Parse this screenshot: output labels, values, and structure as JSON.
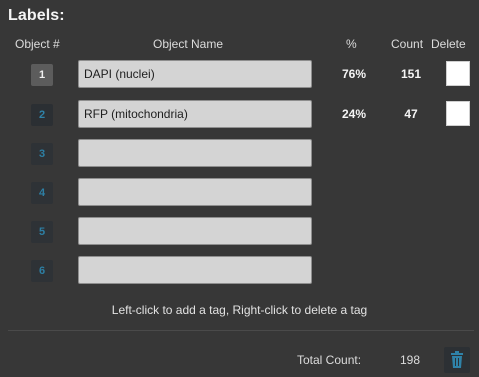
{
  "panel": {
    "title": "Labels:",
    "headers": {
      "object_num": "Object #",
      "object_name": "Object Name",
      "percent": "%",
      "count": "Count",
      "delete": "Delete"
    }
  },
  "objects": [
    {
      "num": "1",
      "name": "DAPI (nuclei)",
      "percent": "76%",
      "count": "151",
      "has_delete": true,
      "active": true
    },
    {
      "num": "2",
      "name": "RFP (mitochondria)",
      "percent": "24%",
      "count": "47",
      "has_delete": true,
      "active": false
    },
    {
      "num": "3",
      "name": "",
      "percent": "",
      "count": "",
      "has_delete": false,
      "active": false
    },
    {
      "num": "4",
      "name": "",
      "percent": "",
      "count": "",
      "has_delete": false,
      "active": false
    },
    {
      "num": "5",
      "name": "",
      "percent": "",
      "count": "",
      "has_delete": false,
      "active": false
    },
    {
      "num": "6",
      "name": "",
      "percent": "",
      "count": "",
      "has_delete": false,
      "active": false
    }
  ],
  "hint": "Left-click to add a tag, Right-click to delete a tag",
  "footer": {
    "total_label": "Total Count:",
    "total_value": "198",
    "trash_icon": "trash-icon"
  },
  "colors": {
    "panel_bg": "#373737",
    "field_bg": "#d4d4d4",
    "number_accent": "#2d7fa4",
    "active_number_bg": "#5c5c5c"
  }
}
